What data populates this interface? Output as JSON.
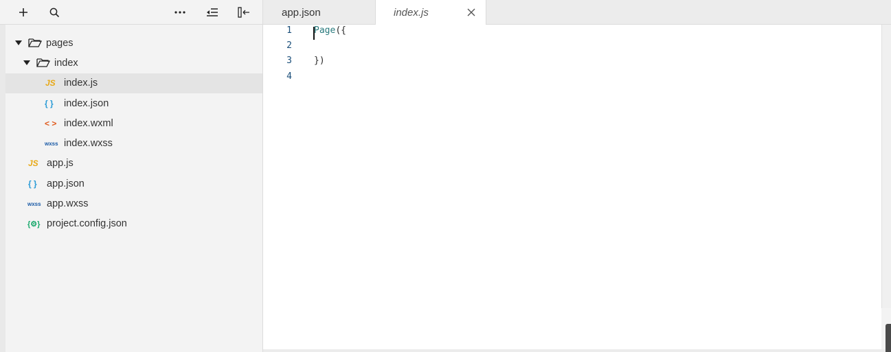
{
  "toolbar": {
    "buttons": [
      {
        "name": "add-icon",
        "glyph": "+"
      },
      {
        "name": "search-icon",
        "glyph": "search"
      },
      {
        "name": "more-icon",
        "glyph": "..."
      },
      {
        "name": "collapse-all-icon",
        "glyph": "collapse"
      },
      {
        "name": "hide-sidebar-icon",
        "glyph": "sidebar"
      }
    ]
  },
  "tree": {
    "items": [
      {
        "label": "pages",
        "type": "folder",
        "depth": 0,
        "expanded": true
      },
      {
        "label": "index",
        "type": "folder",
        "depth": 1,
        "expanded": true
      },
      {
        "label": "index.js",
        "type": "js",
        "icon_text": "JS",
        "depth": 2,
        "selected": true
      },
      {
        "label": "index.json",
        "type": "json",
        "icon_text": "{ }",
        "depth": 2
      },
      {
        "label": "index.wxml",
        "type": "wxml",
        "icon_text": "< >",
        "depth": 2
      },
      {
        "label": "index.wxss",
        "type": "wxss",
        "icon_text": "wxss",
        "depth": 2
      },
      {
        "label": "app.js",
        "type": "js",
        "icon_text": "JS",
        "depth": 0
      },
      {
        "label": "app.json",
        "type": "json",
        "icon_text": "{ }",
        "depth": 0
      },
      {
        "label": "app.wxss",
        "type": "wxss",
        "icon_text": "wxss",
        "depth": 0
      },
      {
        "label": "project.config.json",
        "type": "config",
        "icon_text": "{⚙}",
        "depth": 0
      }
    ]
  },
  "tabs": [
    {
      "label": "app.json",
      "active": false
    },
    {
      "label": "index.js",
      "active": true
    }
  ],
  "editor": {
    "lines": [
      {
        "number": "1",
        "fn": "Page",
        "rest": "({"
      },
      {
        "number": "2",
        "fn": "",
        "rest": ""
      },
      {
        "number": "3",
        "fn": "",
        "rest": "})"
      },
      {
        "number": "4",
        "fn": "",
        "rest": ""
      }
    ]
  },
  "colors": {
    "js": "#e8a917",
    "json": "#2a9bd6",
    "wxml": "#e05a1c",
    "wxss": "#1a5aa6",
    "config": "#17a86b",
    "selected_row": "#e4e4e4",
    "line_number": "#1b4f7a"
  }
}
